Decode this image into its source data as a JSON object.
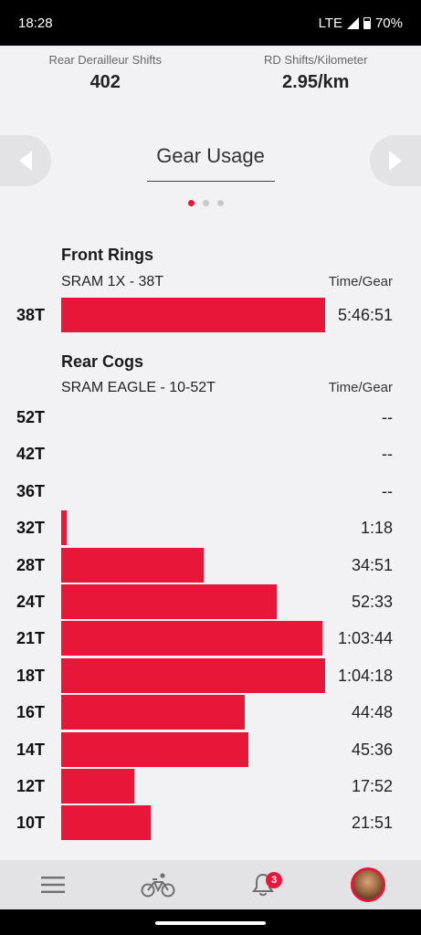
{
  "status": {
    "time": "18:28",
    "network": "LTE",
    "battery": "70%"
  },
  "metrics": [
    {
      "label": "Rear Derailleur Shifts",
      "value": "402"
    },
    {
      "label": "RD Shifts/Kilometer",
      "value": "2.95/km"
    }
  ],
  "section": {
    "title": "Gear Usage",
    "page": 1,
    "pages": 3
  },
  "front": {
    "title": "Front Rings",
    "setup": "SRAM 1X - 38T",
    "column": "Time/Gear",
    "rows": [
      {
        "gear": "38T",
        "time": "5:46:51",
        "fraction": 1.0
      }
    ]
  },
  "rear": {
    "title": "Rear Cogs",
    "setup": "SRAM EAGLE - 10-52T",
    "column": "Time/Gear",
    "rows": [
      {
        "gear": "52T",
        "time": "--",
        "fraction": 0
      },
      {
        "gear": "42T",
        "time": "--",
        "fraction": 0
      },
      {
        "gear": "36T",
        "time": "--",
        "fraction": 0
      },
      {
        "gear": "32T",
        "time": "1:18",
        "fraction": 0.02
      },
      {
        "gear": "28T",
        "time": "34:51",
        "fraction": 0.541
      },
      {
        "gear": "24T",
        "time": "52:33",
        "fraction": 0.817
      },
      {
        "gear": "21T",
        "time": "1:03:44",
        "fraction": 0.991
      },
      {
        "gear": "18T",
        "time": "1:04:18",
        "fraction": 1.0
      },
      {
        "gear": "16T",
        "time": "44:48",
        "fraction": 0.697
      },
      {
        "gear": "14T",
        "time": "45:36",
        "fraction": 0.709
      },
      {
        "gear": "12T",
        "time": "17:52",
        "fraction": 0.278
      },
      {
        "gear": "10T",
        "time": "21:51",
        "fraction": 0.34
      }
    ]
  },
  "bottom_nav": {
    "items": [
      {
        "icon": "menu-icon"
      },
      {
        "icon": "bike-icon"
      },
      {
        "icon": "bell-icon",
        "badge": "3"
      },
      {
        "icon": "avatar"
      }
    ]
  },
  "colors": {
    "accent": "#e8173a",
    "background": "#f2f2f4",
    "nav": "#e3e3e6"
  }
}
